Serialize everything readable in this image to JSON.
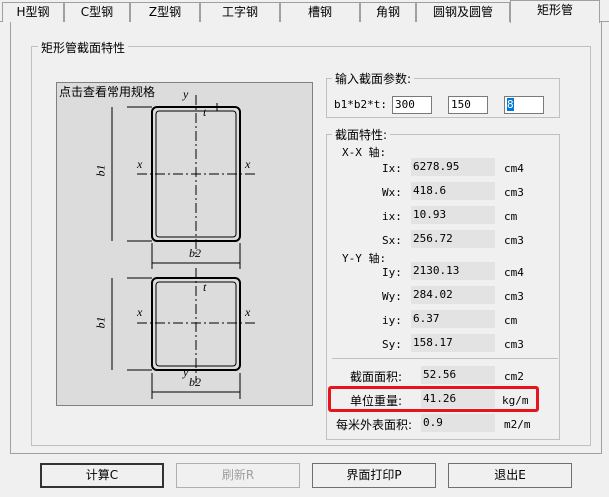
{
  "tabs": [
    "H型钢",
    "C型钢",
    "Z型钢",
    "工字钢",
    "槽钢",
    "角钢",
    "圆钢及圆管",
    "矩形管"
  ],
  "active_tab": "矩形管",
  "main_group_title": "矩形管截面特性",
  "drawing": {
    "hint": "点击查看常用规格",
    "top_shape": {
      "y_label": "y",
      "t_label": "t",
      "x_left": "x",
      "x_right": "x",
      "b1_label": "b1",
      "b2_label": "b2"
    },
    "bottom_shape": {
      "y_label": "y",
      "t_label": "t",
      "x_left": "x",
      "x_right": "x",
      "b1_label": "b1",
      "b2_label": "b2"
    }
  },
  "input_group": {
    "title": "输入截面参数:",
    "label": "b1*b2*t:",
    "b1": "300",
    "b2": "150",
    "t": "8"
  },
  "props_group": {
    "title": "截面特性:",
    "xx_title": "X-X 轴:",
    "yy_title": "Y-Y 轴:",
    "xx_rows": [
      {
        "label": "Ix:",
        "value": "6278.95",
        "unit": "cm4"
      },
      {
        "label": "Wx:",
        "value": "418.6",
        "unit": "cm3"
      },
      {
        "label": "ix:",
        "value": "10.93",
        "unit": "cm"
      },
      {
        "label": "Sx:",
        "value": "256.72",
        "unit": "cm3"
      }
    ],
    "yy_rows": [
      {
        "label": "Iy:",
        "value": "2130.13",
        "unit": "cm4"
      },
      {
        "label": "Wy:",
        "value": "284.02",
        "unit": "cm3"
      },
      {
        "label": "iy:",
        "value": "6.37",
        "unit": "cm"
      },
      {
        "label": "Sy:",
        "value": "158.17",
        "unit": "cm3"
      }
    ],
    "area": {
      "label": "截面面积:",
      "value": "52.56",
      "unit": "cm2"
    },
    "weight": {
      "label": "单位重量:",
      "value": "41.26",
      "unit": "kg/m"
    },
    "surface": {
      "label": "每米外表面积:",
      "value": "0.9",
      "unit": "m2/m"
    }
  },
  "buttons": {
    "calc": "计算C",
    "refresh": "刷新R",
    "print": "界面打印P",
    "exit": "退出E"
  },
  "colors": {
    "highlight": "#e8141c",
    "selection": "#0078d7"
  }
}
